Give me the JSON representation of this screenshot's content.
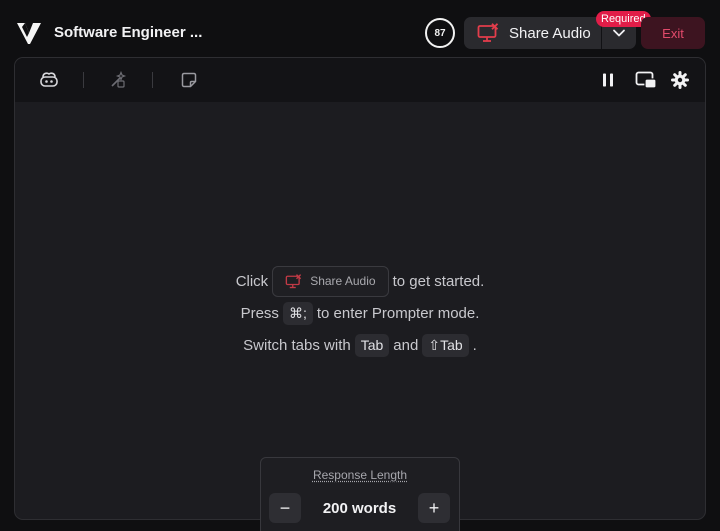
{
  "header": {
    "title": "Software Engineer ...",
    "timer_value": "87",
    "share_audio_label": "Share Audio",
    "required_badge": "Required",
    "exit_label": "Exit"
  },
  "toolbar": {
    "icons": [
      "copilot-icon",
      "magic-wand-icon",
      "sticky-note-icon",
      "pause-icon",
      "picture-in-picture-icon",
      "gear-icon"
    ]
  },
  "instructions": {
    "line1_prefix": "Click",
    "line1_button": "Share Audio",
    "line1_suffix": "to get started.",
    "line2_prefix": "Press",
    "line2_key": "⌘;",
    "line2_suffix": "to enter Prompter mode.",
    "line3_prefix": "Switch tabs with",
    "line3_key1": "Tab",
    "line3_middle": "and",
    "line3_key2_symbol": "⇧",
    "line3_key2": "Tab",
    "line3_suffix": "."
  },
  "response_length": {
    "title": "Response Length",
    "value": "200 words",
    "minus": "−",
    "plus": "+"
  },
  "colors": {
    "background": "#0f0f11",
    "panel": "#1c1c20",
    "accent_red": "#e23d4b",
    "required_badge": "#e11d48",
    "exit_bg": "#3d1420",
    "exit_text": "#e24a6b"
  }
}
